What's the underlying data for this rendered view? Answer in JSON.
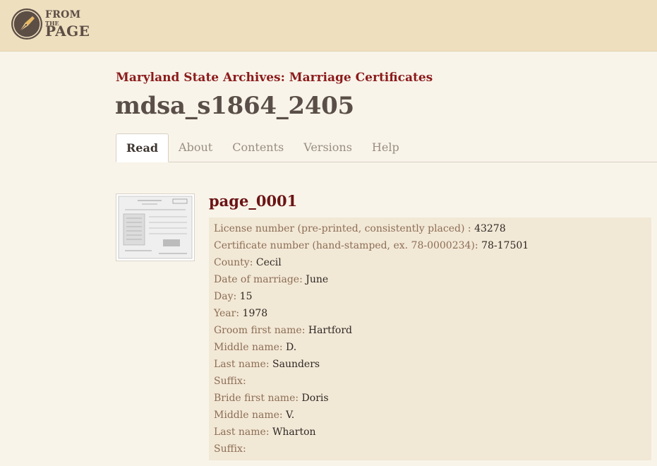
{
  "header": {
    "logo": {
      "line1": "FROM",
      "line2": "THE",
      "line3": "PAGE"
    }
  },
  "collection": {
    "title": "Maryland State Archives: Marriage Certificates"
  },
  "work": {
    "title": "mdsa_s1864_2405"
  },
  "tabs": [
    {
      "label": "Read",
      "active": true
    },
    {
      "label": "About",
      "active": false
    },
    {
      "label": "Contents",
      "active": false
    },
    {
      "label": "Versions",
      "active": false
    },
    {
      "label": "Help",
      "active": false
    }
  ],
  "page": {
    "title": "page_0001",
    "fields": [
      {
        "label": "License number (pre-printed, consistently placed)",
        "sep": " : ",
        "value": "43278"
      },
      {
        "label": "Certificate number (hand-stamped, ex. 78-0000234)",
        "sep": ": ",
        "value": "78-17501"
      },
      {
        "label": "County",
        "sep": ": ",
        "value": "Cecil"
      },
      {
        "label": "Date of marriage",
        "sep": ": ",
        "value": "June"
      },
      {
        "label": "Day",
        "sep": ": ",
        "value": "15"
      },
      {
        "label": "Year",
        "sep": ": ",
        "value": "1978"
      },
      {
        "label": "Groom first name",
        "sep": ": ",
        "value": "Hartford"
      },
      {
        "label": "Middle name",
        "sep": ": ",
        "value": "D."
      },
      {
        "label": "Last name",
        "sep": ": ",
        "value": "Saunders"
      },
      {
        "label": "Suffix",
        "sep": ":",
        "value": ""
      },
      {
        "label": "Bride first name",
        "sep": ": ",
        "value": "Doris"
      },
      {
        "label": "Middle name",
        "sep": ": ",
        "value": "V."
      },
      {
        "label": "Last name",
        "sep": ": ",
        "value": "Wharton"
      },
      {
        "label": "Suffix",
        "sep": ":",
        "value": ""
      }
    ]
  },
  "colors": {
    "header_bg": "#eedfbf",
    "page_bg": "#f8f4ea",
    "accent_red": "#8c1b1b",
    "field_panel_bg": "#f2e8d6",
    "label_brown": "#8c6e55"
  },
  "icons": {
    "logo": "pen-nib-icon"
  }
}
